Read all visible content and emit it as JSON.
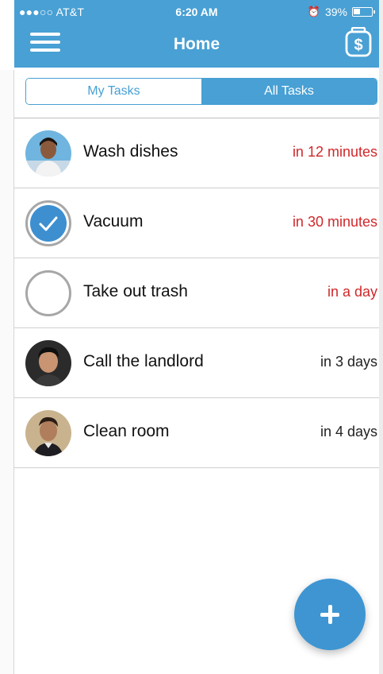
{
  "status_bar": {
    "carrier": "●●●○○ AT&T",
    "time": "6:20 AM",
    "battery": "39%"
  },
  "header": {
    "title": "Home",
    "menu_icon": "hamburger-menu-icon",
    "wallet_icon": "money-jar-icon"
  },
  "tabs": [
    {
      "label": "My Tasks",
      "selected": false
    },
    {
      "label": "All Tasks",
      "selected": true
    }
  ],
  "tasks": [
    {
      "name": "Wash dishes",
      "due": "in 12 minutes",
      "due_color": "#d0282a",
      "status_icon": "avatar-woman"
    },
    {
      "name": "Vacuum",
      "due": "in 30 minutes",
      "due_color": "#d0282a",
      "status_icon": "checked-circle-icon"
    },
    {
      "name": "Take out trash",
      "due": "in a day",
      "due_color": "#d0282a",
      "status_icon": "empty-circle-icon"
    },
    {
      "name": "Call the landlord",
      "due": "in 3 days",
      "due_color": "#222222",
      "status_icon": "avatar-man-1"
    },
    {
      "name": "Clean room",
      "due": "in 4 days",
      "due_color": "#222222",
      "status_icon": "avatar-man-2"
    }
  ],
  "fab": {
    "icon": "plus-icon"
  },
  "colors": {
    "accent": "#48a0d4",
    "urgent": "#d0282a",
    "fab": "#3e95d2"
  }
}
